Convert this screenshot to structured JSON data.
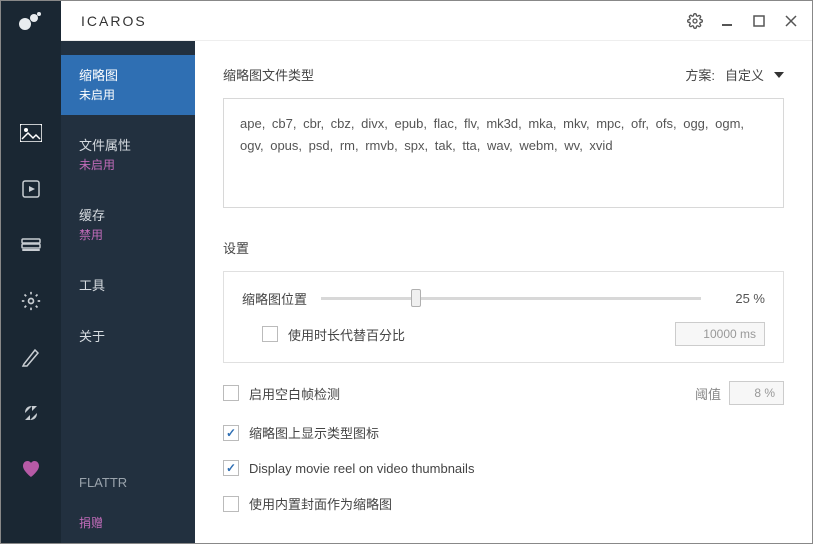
{
  "app": {
    "title": "ICAROS"
  },
  "sidebar": {
    "items": [
      {
        "label": "缩略图",
        "status": "未启用"
      },
      {
        "label": "文件属性",
        "status": "未启用"
      },
      {
        "label": "缓存",
        "status": "禁用"
      },
      {
        "label": "工具",
        "status": ""
      },
      {
        "label": "关于",
        "status": ""
      },
      {
        "label": "FLATTR",
        "status": ""
      },
      {
        "label": "捐赠",
        "status": ""
      }
    ]
  },
  "content": {
    "file_types_label": "缩略图文件类型",
    "scheme_label": "方案:",
    "scheme_value": "自定义",
    "file_types": "ape,  cb7,  cbr,  cbz,  divx,  epub,  flac,  flv,  mk3d,  mka,  mkv,  mpc,  ofr,  ofs,  ogg, ogm,  ogv,  opus,  psd,  rm,  rmvb,  spx,  tak,  tta,  wav,  webm,  wv,  xvid",
    "settings_label": "设置",
    "thumb_pos_label": "缩略图位置",
    "thumb_pos_value": "25 %",
    "thumb_pos_percent": 25,
    "use_duration_label": "使用时长代替百分比",
    "use_duration_value": "10000 ms",
    "opts": [
      {
        "label": "启用空白帧检测",
        "checked": false,
        "right_label": "阈值",
        "right_value": "8 %"
      },
      {
        "label": "缩略图上显示类型图标",
        "checked": true
      },
      {
        "label": "Display movie reel on video thumbnails",
        "checked": true
      },
      {
        "label": "使用内置封面作为缩略图",
        "checked": false
      }
    ]
  }
}
